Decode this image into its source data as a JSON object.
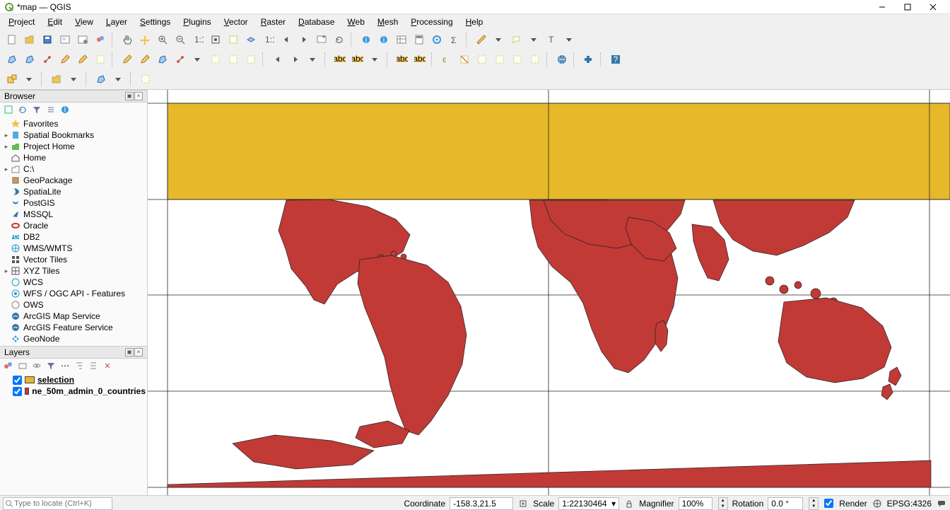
{
  "title": "*map — QGIS",
  "menu": [
    "Project",
    "Edit",
    "View",
    "Layer",
    "Settings",
    "Plugins",
    "Vector",
    "Raster",
    "Database",
    "Web",
    "Mesh",
    "Processing",
    "Help"
  ],
  "browser": {
    "title": "Browser",
    "items": [
      {
        "label": "Favorites",
        "chev": "",
        "icon": "star"
      },
      {
        "label": "Spatial Bookmarks",
        "chev": "▸",
        "icon": "bookmark"
      },
      {
        "label": "Project Home",
        "chev": "▸",
        "icon": "folder-home"
      },
      {
        "label": "Home",
        "chev": "",
        "icon": "house"
      },
      {
        "label": "C:\\",
        "chev": "▸",
        "icon": "folder"
      },
      {
        "label": "GeoPackage",
        "chev": "",
        "icon": "geopackage"
      },
      {
        "label": "SpatiaLite",
        "chev": "",
        "icon": "spatialite"
      },
      {
        "label": "PostGIS",
        "chev": "",
        "icon": "postgis"
      },
      {
        "label": "MSSQL",
        "chev": "",
        "icon": "mssql"
      },
      {
        "label": "Oracle",
        "chev": "",
        "icon": "oracle"
      },
      {
        "label": "DB2",
        "chev": "",
        "icon": "db2"
      },
      {
        "label": "WMS/WMTS",
        "chev": "",
        "icon": "wms"
      },
      {
        "label": "Vector Tiles",
        "chev": "",
        "icon": "vectortiles"
      },
      {
        "label": "XYZ Tiles",
        "chev": "▸",
        "icon": "xyz"
      },
      {
        "label": "WCS",
        "chev": "",
        "icon": "wcs"
      },
      {
        "label": "WFS / OGC API - Features",
        "chev": "",
        "icon": "wfs"
      },
      {
        "label": "OWS",
        "chev": "",
        "icon": "ows"
      },
      {
        "label": "ArcGIS Map Service",
        "chev": "",
        "icon": "arcgis"
      },
      {
        "label": "ArcGIS Feature Service",
        "chev": "",
        "icon": "arcgis"
      },
      {
        "label": "GeoNode",
        "chev": "",
        "icon": "geonode"
      }
    ]
  },
  "layers": {
    "title": "Layers",
    "items": [
      {
        "checked": true,
        "color": "#e6b82a",
        "label": "selection",
        "underline": true
      },
      {
        "checked": true,
        "color": "#c13a36",
        "label": "ne_50m_admin_0_countries",
        "underline": false
      }
    ]
  },
  "locate_placeholder": "Type to locate (Ctrl+K)",
  "status": {
    "coord_label": "Coordinate",
    "coord_value": "-158.3,21.5",
    "scale_label": "Scale",
    "scale_value": "1:22130464",
    "mag_label": "Magnifier",
    "mag_value": "100%",
    "rot_label": "Rotation",
    "rot_value": "0.0 °",
    "render_label": "Render",
    "crs": "EPSG:4326"
  }
}
